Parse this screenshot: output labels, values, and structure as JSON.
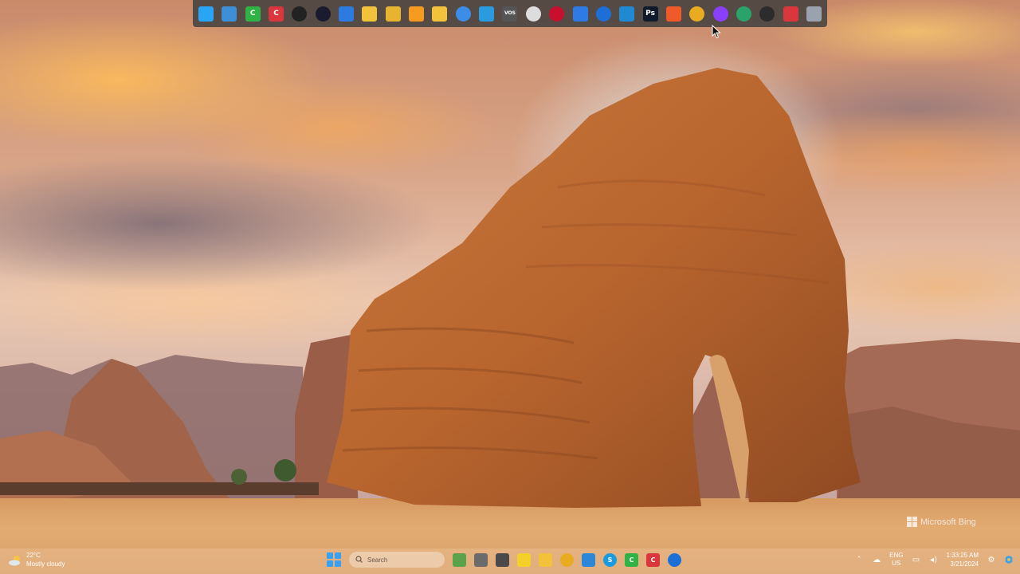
{
  "wallpaper": {
    "credit_label": "Microsoft Bing"
  },
  "top_dock": {
    "items": [
      {
        "name": "windows-start-icon",
        "color": "#2aa4f4"
      },
      {
        "name": "desktop-icon",
        "color": "#3d8fd6"
      },
      {
        "name": "camtasia-green-icon",
        "color": "#2fb344",
        "glyph": "C"
      },
      {
        "name": "camtasia-red-icon",
        "color": "#d9363e",
        "glyph": "C"
      },
      {
        "name": "obs-icon",
        "color": "#222222"
      },
      {
        "name": "app-circle-icon",
        "color": "#1b1b2f"
      },
      {
        "name": "app-blue-square-icon",
        "color": "#2d7be0"
      },
      {
        "name": "folder-icon",
        "color": "#f3c23b"
      },
      {
        "name": "folder-files-icon",
        "color": "#e7b432"
      },
      {
        "name": "search-icon",
        "color": "#f59b20"
      },
      {
        "name": "file-explorer-icon",
        "color": "#f3c23b"
      },
      {
        "name": "sync-icon",
        "color": "#3b8ee8"
      },
      {
        "name": "box-icon",
        "color": "#2b9be0"
      },
      {
        "name": "vos-icon",
        "color": "#555555",
        "glyph": "VOS"
      },
      {
        "name": "clock-icon",
        "color": "#dddddd"
      },
      {
        "name": "opera-icon",
        "color": "#c8102e"
      },
      {
        "name": "docs-icon",
        "color": "#2f7be5"
      },
      {
        "name": "firefox-icon",
        "color": "#1c6fd6"
      },
      {
        "name": "vscode-icon",
        "color": "#1f8ad2"
      },
      {
        "name": "photoshop-icon",
        "color": "#0f1a2b",
        "glyph": "Ps"
      },
      {
        "name": "brave-icon",
        "color": "#f05a28"
      },
      {
        "name": "chrome-icon",
        "color": "#e9ab20"
      },
      {
        "name": "messenger-icon",
        "color": "#8a3ffc"
      },
      {
        "name": "edge-icon",
        "color": "#2aa36b"
      },
      {
        "name": "app-dark-circle-icon",
        "color": "#2c2c2c"
      },
      {
        "name": "power-icon",
        "color": "#d9363e"
      },
      {
        "name": "recycle-bin-icon",
        "color": "#9aa3ad"
      }
    ]
  },
  "taskbar": {
    "weather": {
      "temperature": "22°C",
      "condition": "Mostly cloudy"
    },
    "search_placeholder": "Search",
    "pinned": [
      {
        "name": "chameleon-widget-icon",
        "color": "#5aa34a"
      },
      {
        "name": "task-view-icon",
        "color": "#6b6b6b"
      },
      {
        "name": "calculator-icon",
        "color": "#4a4a4a"
      },
      {
        "name": "sticky-notes-icon",
        "color": "#f4d12a"
      },
      {
        "name": "file-explorer-icon",
        "color": "#f3c23b"
      },
      {
        "name": "chrome-icon",
        "color": "#e9ab20"
      },
      {
        "name": "notepad-icon",
        "color": "#2b88d8"
      },
      {
        "name": "skype-icon",
        "color": "#1a9be0",
        "glyph": "S"
      },
      {
        "name": "camtasia-green-icon",
        "color": "#2fb344",
        "glyph": "C"
      },
      {
        "name": "camtasia-red-icon",
        "color": "#d9363e",
        "glyph": "C"
      },
      {
        "name": "firefox-icon",
        "color": "#1c6fd6"
      }
    ],
    "tray": {
      "language": "ENG",
      "region": "US",
      "time": "1:33:25 AM",
      "date": "3/21/2024"
    }
  }
}
